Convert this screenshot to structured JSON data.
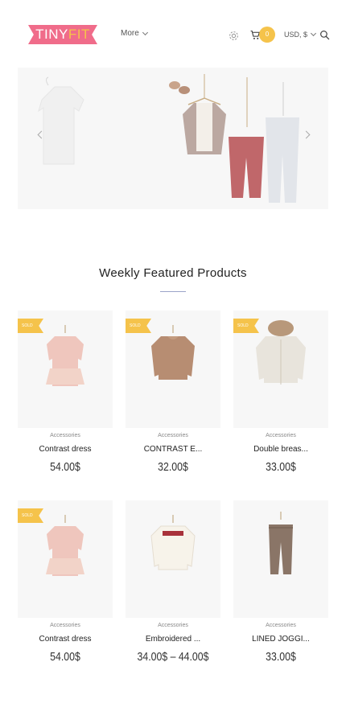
{
  "header": {
    "logo_tiny": "TINY",
    "logo_fit": "FIT",
    "more_label": "More",
    "cart_count": "0",
    "currency_label": "USD, $"
  },
  "section": {
    "title": "Weekly Featured Products"
  },
  "products": [
    {
      "tag": "SOLD",
      "category": "Accessories",
      "name": "Contrast dress",
      "price": "54.00$",
      "colors": [
        "#efc6bd",
        "#f2d3c8"
      ]
    },
    {
      "tag": "SOLD",
      "category": "Accessories",
      "name": "CONTRAST E...",
      "price": "32.00$",
      "colors": [
        "#b78d72",
        "#c49c80"
      ]
    },
    {
      "tag": "SOLD",
      "category": "Accessories",
      "name": "Double breas...",
      "price": "33.00$",
      "colors": [
        "#e8e4dc",
        "#cfc7b8"
      ]
    },
    {
      "tag": "SOLD",
      "category": "Accessories",
      "name": "Contrast dress",
      "price": "54.00$",
      "colors": [
        "#efc6bd",
        "#f2d3c8"
      ]
    },
    {
      "tag": "",
      "category": "Accessories",
      "name": "Embroidered ...",
      "price": "34.00$ – 44.00$",
      "colors": [
        "#f7f3ea",
        "#a8313a"
      ]
    },
    {
      "tag": "",
      "category": "Accessories",
      "name": "LINED JOGGI...",
      "price": "33.00$",
      "colors": [
        "#8a7567",
        "#7d695b"
      ]
    }
  ],
  "colors": {
    "brand_pink": "#f06c8a",
    "accent_yellow": "#f5c34b",
    "underline_blue": "#9aa4c8"
  }
}
